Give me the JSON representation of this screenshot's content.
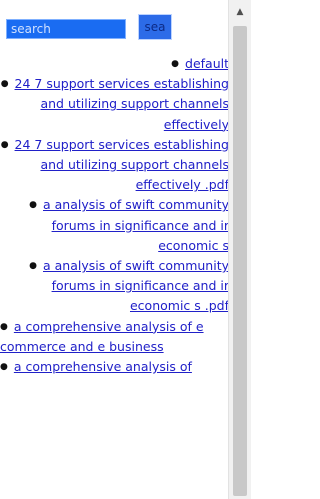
{
  "search": {
    "placeholder": "search",
    "button_label": "sea"
  },
  "results": [
    {
      "label": "default",
      "bullet": true,
      "align": "right"
    },
    {
      "label": "24 7 support services establishing and utilizing support channels effectively",
      "bullet": true,
      "align": "right"
    },
    {
      "label": "24 7 support services establishing and utilizing support channels effectively .pdf",
      "bullet": true,
      "align": "right"
    },
    {
      "label": "a analysis of swift community forums in significance and ir economic s",
      "bullet": true,
      "align": "right"
    },
    {
      "label": "a analysis of swift community forums in significance and ir economic s .pdf",
      "bullet": true,
      "align": "right"
    },
    {
      "label": "a comprehensive analysis of e commerce and e business",
      "bullet": true,
      "align": "left"
    },
    {
      "label": "a comprehensive analysis of",
      "bullet": true,
      "align": "left"
    }
  ],
  "scrollbar": {
    "up_arrow_icon": "triangle-up"
  }
}
